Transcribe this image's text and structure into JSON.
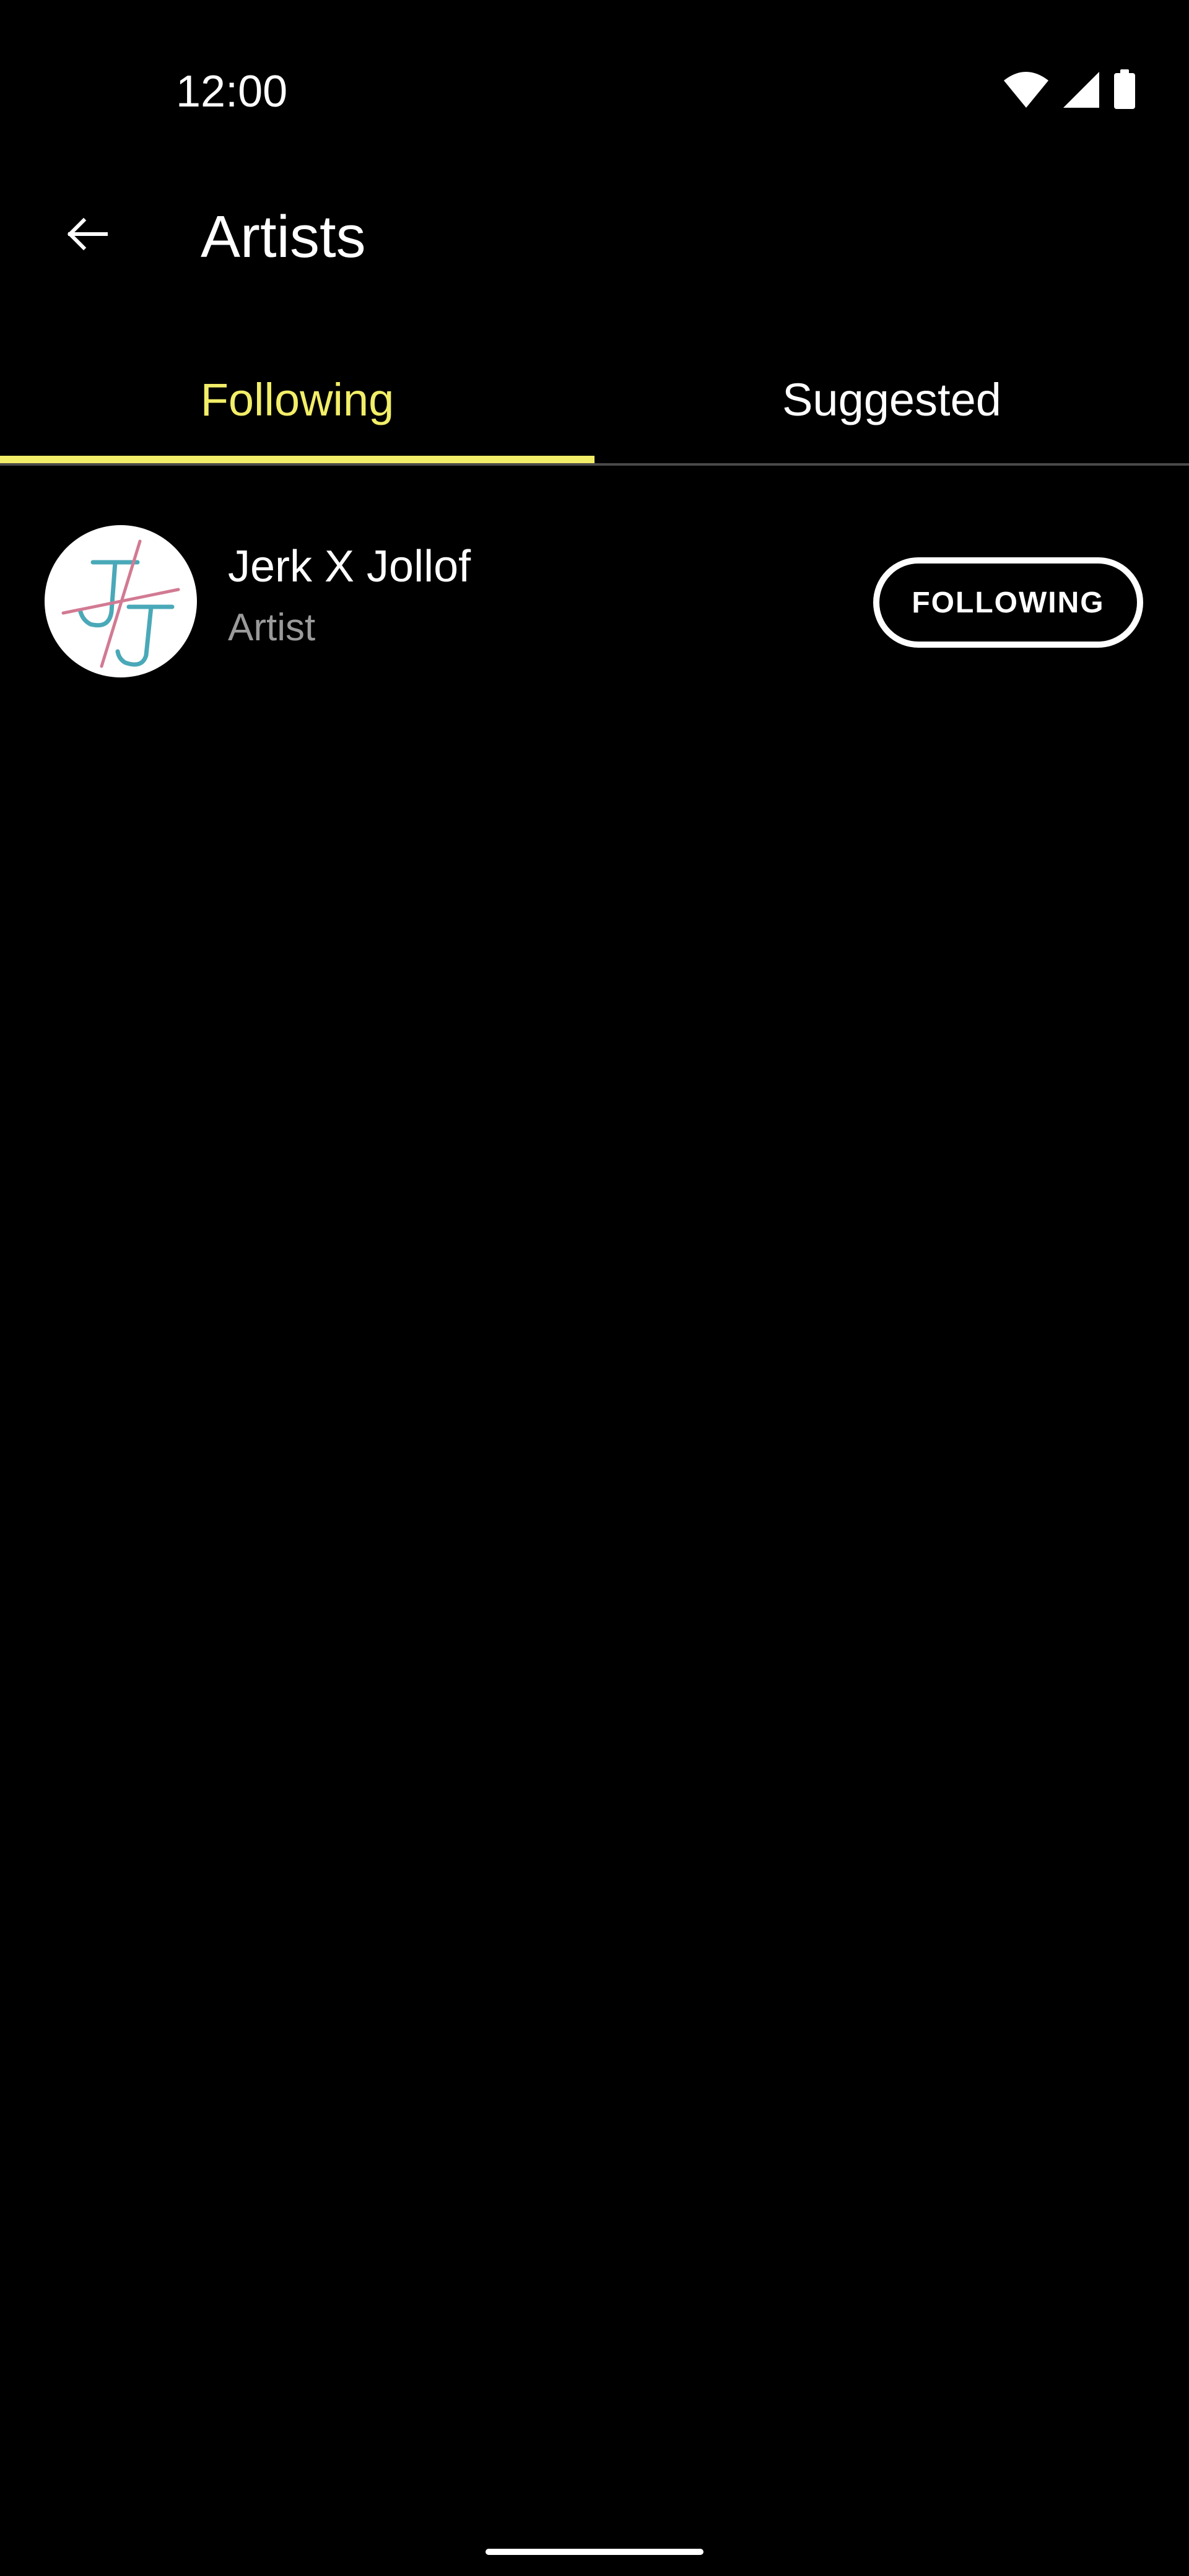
{
  "status_bar": {
    "time": "12:00",
    "icons": [
      "wifi-icon",
      "signal-icon",
      "battery-icon"
    ]
  },
  "app_bar": {
    "back_icon": "back-arrow-icon",
    "title": "Artists"
  },
  "tabs": [
    {
      "label": "Following",
      "selected": true
    },
    {
      "label": "Suggested",
      "selected": false
    }
  ],
  "artists": [
    {
      "name": "Jerk X Jollof",
      "type": "Artist",
      "button_label": "FOLLOWING"
    }
  ],
  "colors": {
    "background": "#000000",
    "accent": "#f2ee68",
    "text_primary": "#ffffff",
    "text_secondary": "#9a9a9a"
  }
}
